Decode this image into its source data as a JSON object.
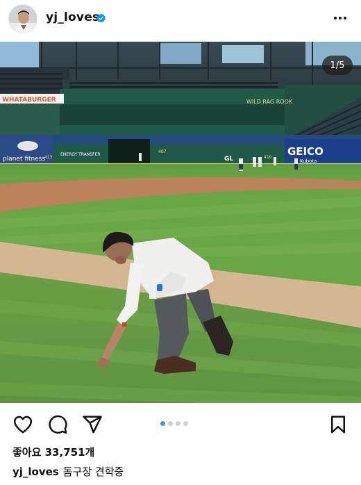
{
  "post": {
    "username": "yj_loves",
    "verified": true,
    "image_counter": "1/5",
    "image_index": 1,
    "image_total": 5,
    "likes_text": "좋아요 33,751개",
    "caption_user": "yj_loves",
    "caption_text": "돔구장 견학중"
  },
  "photo": {
    "signage": {
      "whataburger": "WHATABURGER",
      "wild_rag": "WILD RAG ROOK",
      "planet_fitness": "planet fitness",
      "energy_transfer": "ENERGY TRANSFER",
      "geico": "GEICO",
      "kubota": "Kubota",
      "gl": "GL",
      "dist_407": "407",
      "dist_410": "410",
      "dist_413": "413"
    }
  },
  "colors": {
    "accent": "#3897f0",
    "verified": "#0095f6",
    "text": "#111111"
  },
  "icons": [
    "more-icon",
    "heart-icon",
    "comment-icon",
    "share-icon",
    "bookmark-icon",
    "verified-icon"
  ]
}
